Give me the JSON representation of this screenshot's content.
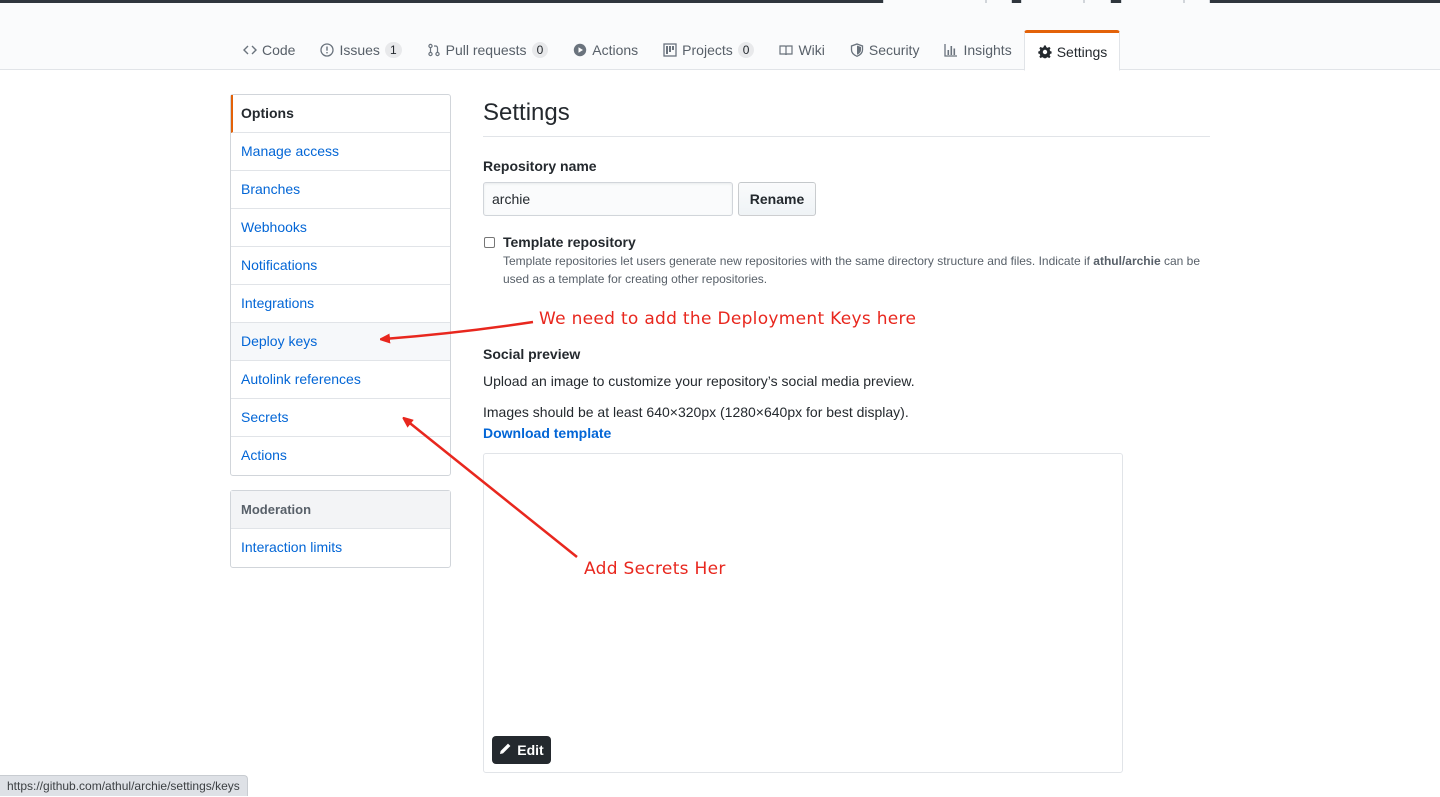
{
  "tabs": [
    {
      "label": "Code",
      "icon": "code-icon"
    },
    {
      "label": "Issues",
      "icon": "issue-icon",
      "count": "1"
    },
    {
      "label": "Pull requests",
      "icon": "pull-request-icon",
      "count": "0"
    },
    {
      "label": "Actions",
      "icon": "play-icon"
    },
    {
      "label": "Projects",
      "icon": "project-icon",
      "count": "0"
    },
    {
      "label": "Wiki",
      "icon": "book-icon"
    },
    {
      "label": "Security",
      "icon": "shield-icon"
    },
    {
      "label": "Insights",
      "icon": "graph-icon"
    },
    {
      "label": "Settings",
      "icon": "gear-icon",
      "selected": true
    }
  ],
  "sidebar": {
    "items": [
      {
        "label": "Options",
        "selected": true
      },
      {
        "label": "Manage access"
      },
      {
        "label": "Branches"
      },
      {
        "label": "Webhooks"
      },
      {
        "label": "Notifications"
      },
      {
        "label": "Integrations"
      },
      {
        "label": "Deploy keys",
        "hover": true
      },
      {
        "label": "Autolink references"
      },
      {
        "label": "Secrets"
      },
      {
        "label": "Actions"
      }
    ],
    "moderation_heading": "Moderation",
    "moderation_items": [
      {
        "label": "Interaction limits"
      }
    ]
  },
  "main": {
    "title": "Settings",
    "repo_name_label": "Repository name",
    "repo_name_value": "archie",
    "rename_button": "Rename",
    "template_label": "Template repository",
    "template_note_before": "Template repositories let users generate new repositories with the same directory structure and files. Indicate if ",
    "template_note_bold": "athul/archie",
    "template_note_after": " can be used as a template for creating other repositories.",
    "social_heading": "Social preview",
    "social_desc": "Upload an image to customize your repository’s social media preview.",
    "social_size": "Images should be at least 640×320px (1280×640px for best display).",
    "download_template": "Download template",
    "edit_button": "Edit"
  },
  "annotations": {
    "deploy_note": "We need to add the Deployment Keys here",
    "secrets_note": "Add Secrets Her",
    "color": "#e8271e"
  },
  "status_url": "https://github.com/athul/archie/settings/keys"
}
